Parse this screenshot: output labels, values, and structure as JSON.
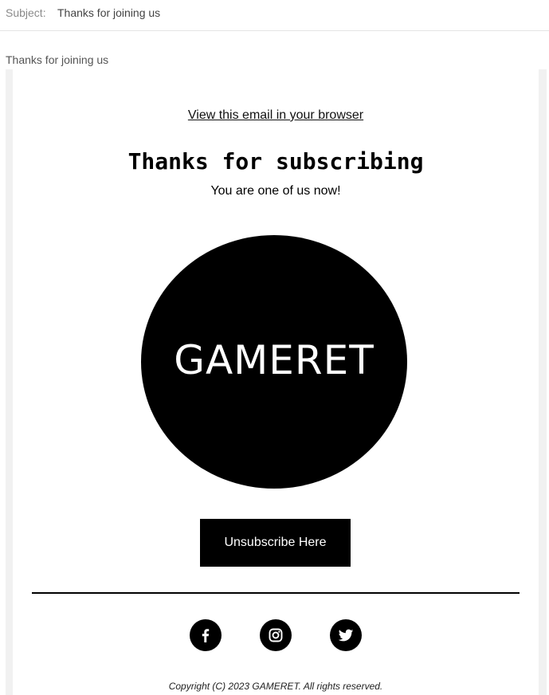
{
  "header": {
    "subject_label": "Subject:",
    "subject_value": "Thanks for joining us"
  },
  "preheader": "Thanks for joining us",
  "email": {
    "browser_link": "View this email in your browser",
    "headline": "Thanks for subscribing",
    "subline": "You are one of us now!",
    "logo_text": "GAMERET",
    "unsubscribe_label": "Unsubscribe Here",
    "social": [
      {
        "icon": "facebook-icon"
      },
      {
        "icon": "instagram-icon"
      },
      {
        "icon": "twitter-icon"
      }
    ],
    "copyright": "Copyright (C) 2023 GAMERET. All rights reserved."
  },
  "colors": {
    "background": "#ffffff",
    "frame": "#f1f1f1",
    "accent": "#000000",
    "accent_text": "#ffffff"
  }
}
